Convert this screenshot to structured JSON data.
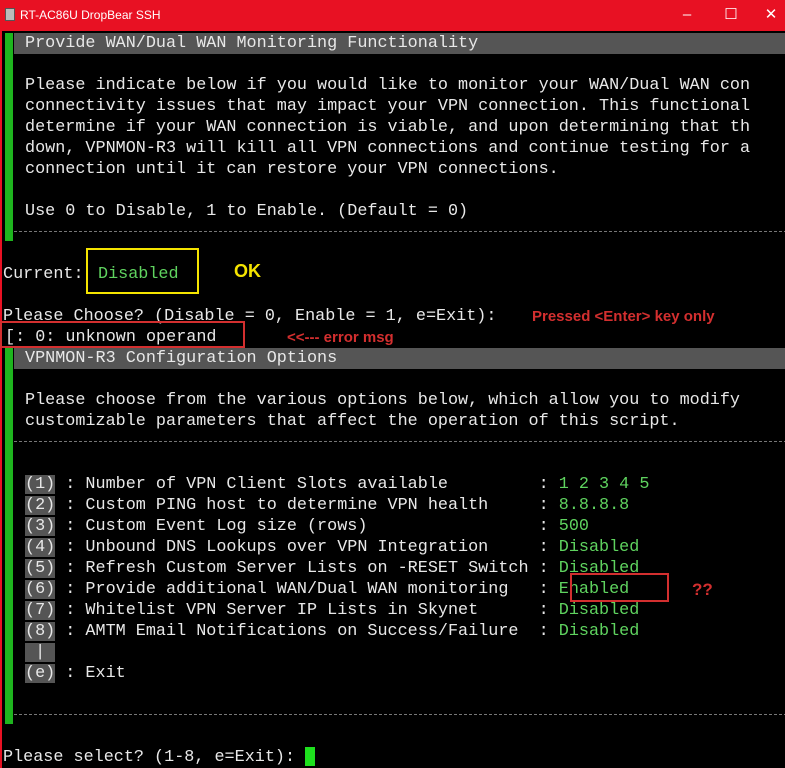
{
  "window": {
    "title": "RT-AC86U DropBear SSH",
    "minimize": "–",
    "maximize": "☐",
    "close": "✕"
  },
  "section1": {
    "header": "Provide WAN/Dual WAN Monitoring Functionality",
    "lines": [
      "Please indicate below if you would like to monitor your WAN/Dual WAN con",
      "connectivity issues that may impact your VPN connection. This functional",
      "determine if your WAN connection is viable, and upon determining that th",
      "down, VPNMON-R3 will kill all VPN connections and continue testing for a",
      "connection until it can restore your VPN connections."
    ],
    "usage": "Use 0 to Disable, 1 to Enable. (Default = 0)",
    "current_label": "Current:",
    "current_value": "Disabled",
    "prompt": "Please Choose? (Disable = 0, Enable = 1, e=Exit):",
    "error": "[: 0: unknown operand"
  },
  "section2": {
    "header": "VPNMON-R3 Configuration Options",
    "lines": [
      "Please choose from the various options below, which allow you to modify",
      "customizable parameters that affect the operation of this script."
    ],
    "items": [
      {
        "key": "(1)",
        "label": " : Number of VPN Client Slots available         : ",
        "value": "1 2 3 4 5"
      },
      {
        "key": "(2)",
        "label": " : Custom PING host to determine VPN health     : ",
        "value": "8.8.8.8"
      },
      {
        "key": "(3)",
        "label": " : Custom Event Log size (rows)                 : ",
        "value": "500"
      },
      {
        "key": "(4)",
        "label": " : Unbound DNS Lookups over VPN Integration     : ",
        "value": "Disabled"
      },
      {
        "key": "(5)",
        "label": " : Refresh Custom Server Lists on -RESET Switch : ",
        "value": "Disabled"
      },
      {
        "key": "(6)",
        "label": " : Provide additional WAN/Dual WAN monitoring   : ",
        "value": "Enabled"
      },
      {
        "key": "(7)",
        "label": " : Whitelist VPN Server IP Lists in Skynet      : ",
        "value": "Disabled"
      },
      {
        "key": "(8)",
        "label": " : AMTM Email Notifications on Success/Failure  : ",
        "value": "Disabled"
      }
    ],
    "separator": " | ",
    "exit_key": "(e)",
    "exit_label": " : Exit",
    "prompt": "Please select? (1-8, e=Exit): "
  },
  "annotations": {
    "ok": "OK",
    "pressed": "Pressed <Enter> key only",
    "error_msg": "<<--- error msg",
    "question": "??"
  },
  "colors": {
    "titlebar": "#e81123",
    "accent_green": "#1eb51e",
    "value_green": "#5fd35f",
    "annotation_red": "#d32f2f",
    "annotation_yellow": "#f5e400"
  }
}
